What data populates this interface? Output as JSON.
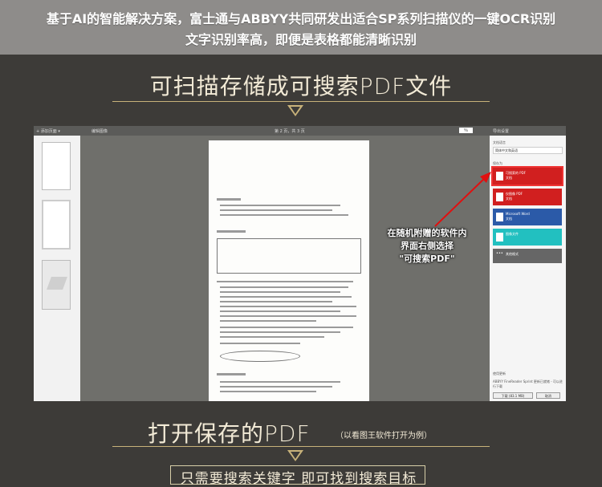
{
  "banner": {
    "line1": "基于AI的智能解决方案，富士通与ABBYY共同研发出适合SP系列扫描仪的一键OCR识别",
    "line2": "文字识别率高，即便是表格都能清晰识别"
  },
  "headline1": "可扫描存储成可搜索PDF文件",
  "app": {
    "toolbar": {
      "add_pages": "+ 添加页面 ▾",
      "edit_image": "编辑图像",
      "page_info": "第 2 页，共 3 页",
      "zoom": "％",
      "export_settings": "导出设置"
    },
    "panel": {
      "doc_type_label": "文档语言",
      "doc_type_value": "简体中文和英语",
      "save_as_label": "保存为",
      "options": [
        {
          "label": "可搜索的 PDF",
          "sub": "文档",
          "color": "#d11f1f"
        },
        {
          "label": "仅图像 PDF",
          "sub": "文档",
          "color": "#d11f1f"
        },
        {
          "label": "Microsoft Word",
          "sub": "文档",
          "color": "#2b5aa8"
        },
        {
          "label": "图像文件",
          "sub": "",
          "color": "#22c0c0"
        },
        {
          "label": "其他格式",
          "sub": "",
          "color": "#666666"
        }
      ],
      "footer_label": "使用更新",
      "footer_text": "ABBYY FineReader Sprint 更新已就绪 - 可以进行下载",
      "ok_btn": "下载 (83.1 MB)",
      "cancel_btn": "取消"
    },
    "document": {
      "section1": "一、适用要求",
      "section2": "二、基本要求",
      "section3": "三、产品报表类"
    }
  },
  "callout": {
    "line1": "在随机附赠的软件内",
    "line2": "界面右侧选择",
    "line3": "\"可搜索PDF\""
  },
  "headline2": "打开保存的PDF",
  "headline2_note": "（以看图王软件打开为例）",
  "search_hint": "只需要搜索关键字 即可找到搜索目标",
  "colors": {
    "accent_gold": "#c8b27a",
    "banner_gray": "#8e8c8a",
    "background": "#3d3b38"
  }
}
